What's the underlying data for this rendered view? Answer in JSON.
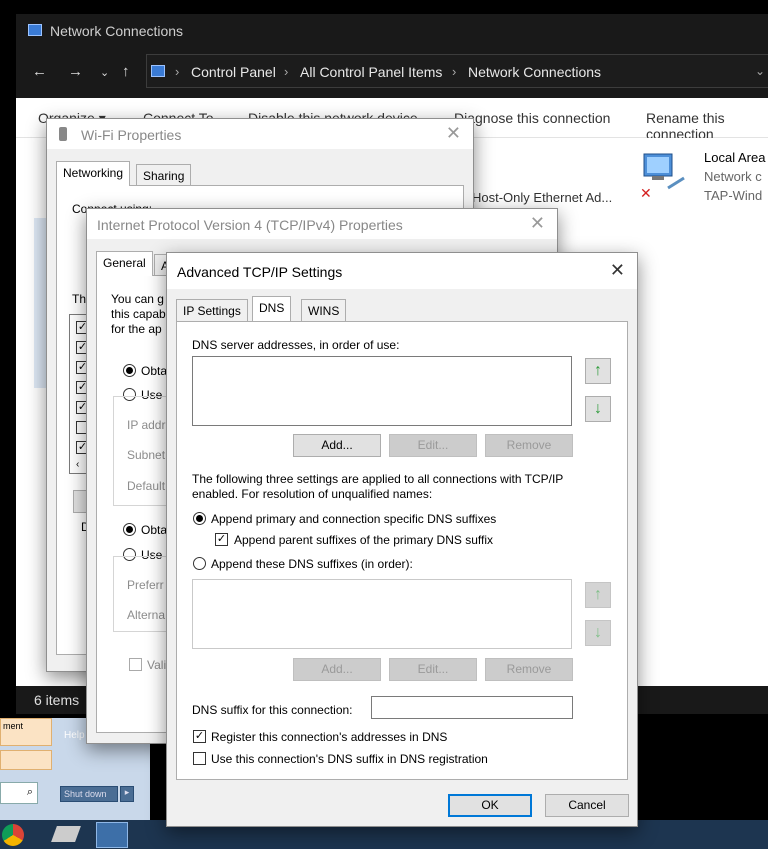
{
  "explorer": {
    "title": "Network Connections",
    "breadcrumb": [
      "Control Panel",
      "All Control Panel Items",
      "Network Connections"
    ],
    "commands": [
      "Organize ▾",
      "Connect To",
      "Disable this network device",
      "Diagnose this connection",
      "Rename this connection"
    ],
    "items": [
      {
        "name": "Host-Only Ethernet Ad..."
      },
      {
        "name": "Local Area",
        "status": "Network c",
        "device": "TAP-Wind"
      }
    ],
    "status_count": "6 items"
  },
  "wifi_dialog": {
    "title": "Wi-Fi Properties",
    "tabs": [
      "Networking",
      "Sharing"
    ],
    "connect_using": "Connect using:",
    "this_conn": "Th",
    "dialog_ok": "Valid"
  },
  "ipv4_dialog": {
    "title": "Internet Protocol Version 4 (TCP/IPv4) Properties",
    "tabs": [
      "General",
      "A"
    ],
    "desc": [
      "You can g",
      "this capab",
      "for the ap"
    ],
    "radio_obtain_ip": "Obta",
    "radio_use_ip": "Use",
    "ip_addr": "IP addr",
    "subnet": "Subnet",
    "default_gw": "Default",
    "radio_obtain_dns": "Obta",
    "radio_use_dns": "Use",
    "preferred": "Preferr",
    "alternate": "Alterna",
    "validate": "Vali"
  },
  "advanced_dialog": {
    "title": "Advanced TCP/IP Settings",
    "tabs": [
      "IP Settings",
      "DNS",
      "WINS"
    ],
    "dns_servers_label": "DNS server addresses, in order of use:",
    "add": "Add...",
    "edit": "Edit...",
    "remove": "Remove",
    "info_line1": "The following three settings are applied to all connections with TCP/IP",
    "info_line2": "enabled. For resolution of unqualified names:",
    "radio_append_primary": "Append primary and connection specific DNS suffixes",
    "check_append_parent": "Append parent suffixes of the primary DNS suffix",
    "radio_append_these": "Append these DNS suffixes (in order):",
    "add2": "Add...",
    "edit2": "Edit...",
    "remove2": "Remove",
    "suffix_label": "DNS suffix for this connection:",
    "suffix_value": "",
    "check_register": "Register this connection's addresses in DNS",
    "check_use_suffix": "Use this connection's DNS suffix in DNS registration",
    "ok": "OK",
    "cancel": "Cancel"
  },
  "win7": {
    "help": "Help",
    "shutdown": "Shut down",
    "ment": "ment"
  }
}
